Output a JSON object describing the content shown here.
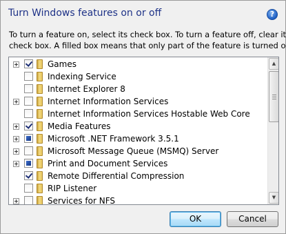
{
  "dialog": {
    "title": "Turn Windows features on or off",
    "help_icon": "question-mark",
    "description_line1": "To turn a feature on, select its check box. To turn a feature off, clear its",
    "description_line2": "check box. A filled box means that only part of the feature is turned on."
  },
  "features": [
    {
      "label": "Games",
      "expandable": true,
      "state": "checked"
    },
    {
      "label": "Indexing Service",
      "expandable": false,
      "state": "unchecked"
    },
    {
      "label": "Internet Explorer 8",
      "expandable": false,
      "state": "unchecked"
    },
    {
      "label": "Internet Information Services",
      "expandable": true,
      "state": "unchecked"
    },
    {
      "label": "Internet Information Services Hostable Web Core",
      "expandable": false,
      "state": "unchecked"
    },
    {
      "label": "Media Features",
      "expandable": true,
      "state": "checked"
    },
    {
      "label": "Microsoft .NET Framework 3.5.1",
      "expandable": true,
      "state": "partial"
    },
    {
      "label": "Microsoft Message Queue (MSMQ) Server",
      "expandable": true,
      "state": "unchecked"
    },
    {
      "label": "Print and Document Services",
      "expandable": true,
      "state": "partial"
    },
    {
      "label": "Remote Differential Compression",
      "expandable": false,
      "state": "checked"
    },
    {
      "label": "RIP Listener",
      "expandable": false,
      "state": "unchecked"
    },
    {
      "label": "Services for NFS",
      "expandable": true,
      "state": "unchecked"
    }
  ],
  "buttons": {
    "ok": "OK",
    "cancel": "Cancel"
  }
}
